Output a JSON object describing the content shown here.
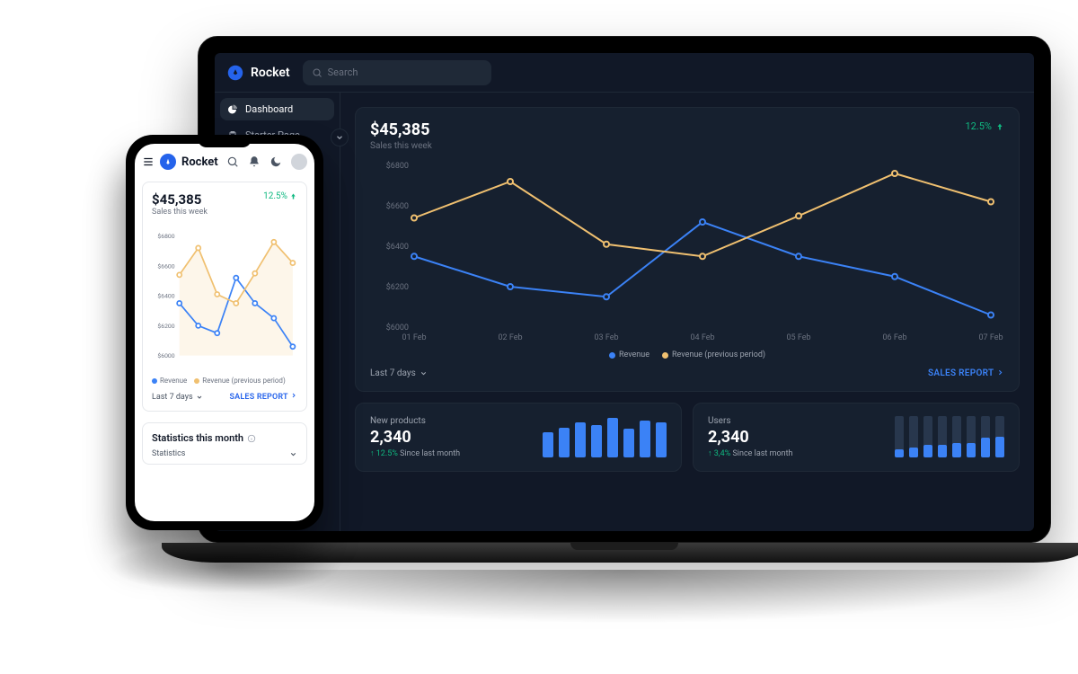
{
  "brand": "Rocket",
  "search_placeholder": "Search",
  "sidebar": {
    "items": [
      {
        "label": "Dashboard"
      },
      {
        "label": "Starter Page"
      }
    ]
  },
  "sales": {
    "amount": "$45,385",
    "subtitle": "Sales this week",
    "delta": "12.5%",
    "range_select": "Last 7 days",
    "report_link": "SALES REPORT"
  },
  "legend": {
    "revenue": "Revenue",
    "prev": "Revenue (previous period)"
  },
  "stats": {
    "products": {
      "title": "New products",
      "value": "2,340",
      "delta": "12.5%",
      "since": "Since last month"
    },
    "users": {
      "title": "Users",
      "value": "2,340",
      "delta": "3,4%",
      "since": "Since last month"
    }
  },
  "mobile": {
    "stats_header": "Statistics this month",
    "stats_select": "Statistics"
  },
  "chart_data": {
    "type": "line",
    "title": "Sales this week",
    "ylabel": "",
    "xlabel": "",
    "ylim": [
      6000,
      6800
    ],
    "yticks": [
      6000,
      6200,
      6400,
      6600,
      6800
    ],
    "ytick_labels": [
      "$6000",
      "$6200",
      "$6400",
      "$6600",
      "$6800"
    ],
    "categories": [
      "01 Feb",
      "02 Feb",
      "03 Feb",
      "04 Feb",
      "05 Feb",
      "06 Feb",
      "07 Feb"
    ],
    "series": [
      {
        "name": "Revenue",
        "color": "#3b82f6",
        "values": [
          6350,
          6200,
          6150,
          6520,
          6350,
          6250,
          6060
        ]
      },
      {
        "name": "Revenue (previous period)",
        "color": "#f0c070",
        "values": [
          6540,
          6720,
          6410,
          6350,
          6550,
          6760,
          6620
        ]
      }
    ]
  },
  "mini_products_bars": [
    60,
    72,
    85,
    78,
    95,
    70,
    90,
    84
  ],
  "mini_users_bars": [
    {
      "total": 100,
      "fill": 20
    },
    {
      "total": 100,
      "fill": 25
    },
    {
      "total": 100,
      "fill": 30
    },
    {
      "total": 100,
      "fill": 30
    },
    {
      "total": 100,
      "fill": 35
    },
    {
      "total": 100,
      "fill": 35
    },
    {
      "total": 100,
      "fill": 48
    },
    {
      "total": 100,
      "fill": 50
    }
  ]
}
